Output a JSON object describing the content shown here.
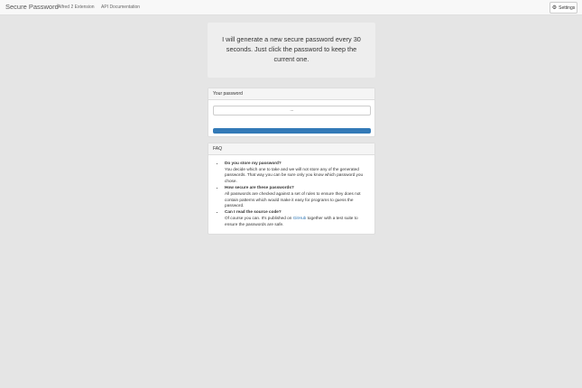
{
  "navbar": {
    "brand": "Secure Password",
    "links": [
      "Alfred 2 Extension",
      "API Documentation"
    ],
    "settings_label": "Settings",
    "settings_icon": "gear-icon"
  },
  "intro": {
    "text": "I will generate a new secure password every 30 seconds. Just click the password to keep the current one."
  },
  "password_panel": {
    "heading": "Your password",
    "value": "...",
    "countdown_progress": 1.0
  },
  "faq": {
    "heading": "FAQ",
    "items": [
      {
        "question": "Do you store my password?",
        "answer": "You decide which one to take and we will not store any of the generated passwords. That way you can be sure only you know which password you chose."
      },
      {
        "question": "How secure are these passwords?",
        "answer": "All passwords are checked against a set of rules to ensure they does not contain patterns which would make it easy for programs to guess the password."
      },
      {
        "question": "Can I read the source code?",
        "answer_before_link": "Of course you can. It's published on ",
        "link_text": "GitHub",
        "answer_after_link": " together with a test suite to ensure the passwords are safe."
      }
    ]
  },
  "colors": {
    "background": "#e5e5e5",
    "progress": "#337ab7",
    "link": "#337ab7"
  }
}
